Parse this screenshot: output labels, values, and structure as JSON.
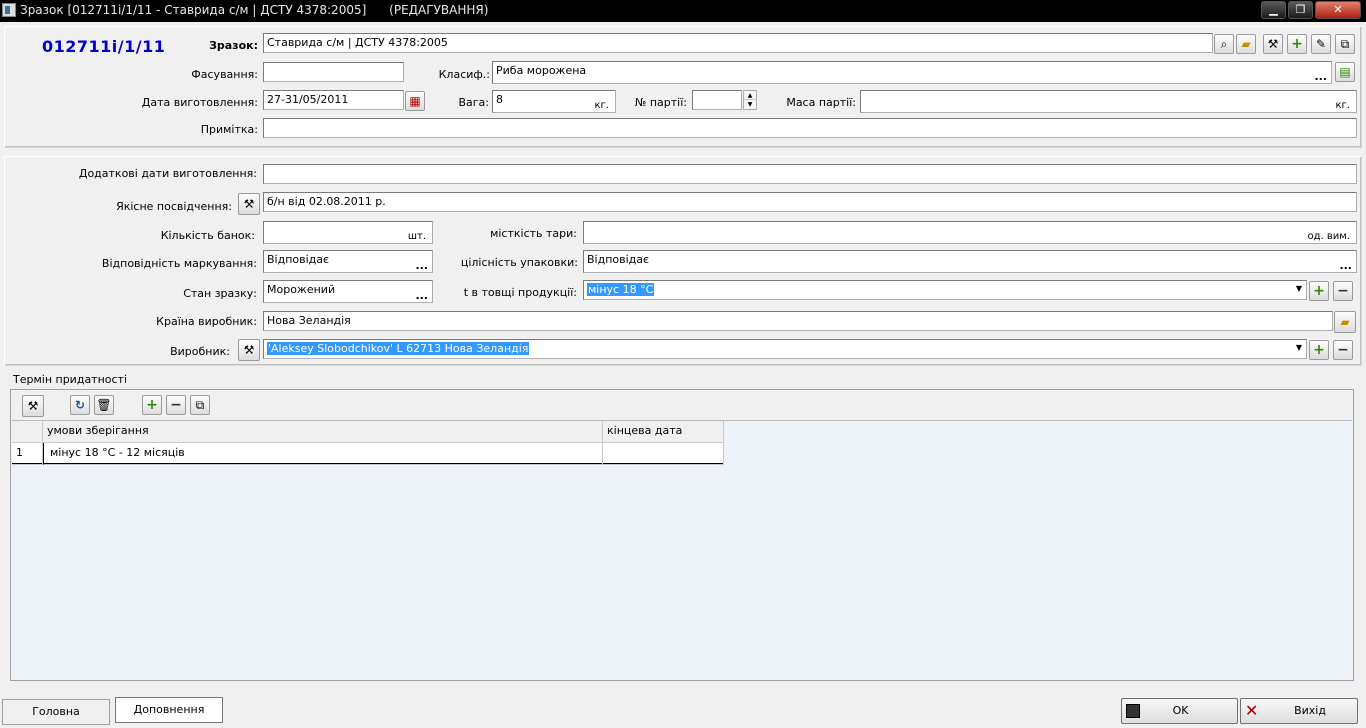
{
  "window": {
    "title": "Зразок [012711i/1/11 - Ставрида с/м | ДСТУ 4378:2005]      (РЕДАГУВАННЯ)"
  },
  "header": {
    "code": "012711i/1/11",
    "sample_label": "Зразок:",
    "sample_value": "Ставрида с/м | ДСТУ 4378:2005",
    "packing_label": "Фасування:",
    "packing_value": "",
    "class_label": "Класиф.:",
    "class_value": "Риба морожена",
    "mfg_date_label": "Дата виготовлення:",
    "mfg_date_value": "27-31/05/2011",
    "weight_label": "Вага:",
    "weight_value": "8",
    "weight_unit": "кг.",
    "batch_label": "№ партії:",
    "batch_value": "",
    "batch_mass_label": "Маса партії:",
    "batch_mass_value": "",
    "batch_mass_unit": "кг.",
    "note_label": "Примітка:",
    "note_value": ""
  },
  "details": {
    "extra_dates_label": "Додаткові дати виготовлення:",
    "extra_dates_value": "",
    "quality_cert_label": "Якісне посвідчення:",
    "quality_cert_value": "б/н від 02.08.2011 р.",
    "cans_label": "Кількість банок:",
    "cans_value": "",
    "cans_unit": "шт.",
    "capacity_label": "місткість тари:",
    "capacity_value": "",
    "capacity_unit": "од. вим.",
    "marking_label": "Відповідність маркування:",
    "marking_value": "Відповідає",
    "integrity_label": "цілісність упаковки:",
    "integrity_value": "Відповідає",
    "state_label": "Стан зразку:",
    "state_value": "Морожений",
    "temp_label": "t в товщі продукції:",
    "temp_value": "мінус 18 °С",
    "country_label": "Країна виробник:",
    "country_value": "Нова Зеландія",
    "producer_label": "Виробник:",
    "producer_value": "'Aleksey Slobodchikov' L 62713 Нова Зеландія"
  },
  "shelf_life": {
    "group_title": "Термін придатності",
    "columns": [
      "умови зберігання",
      "кінцева дата"
    ],
    "rows": [
      {
        "num": "1",
        "conditions": "мінус 18 °С - 12 місяців",
        "end_date": ""
      }
    ]
  },
  "footer": {
    "tab_main": "Головна",
    "tab_extra": "Доповнення",
    "ok_label": "OK",
    "exit_label": "Вихід"
  },
  "icons": {
    "search": "binoculars-icon",
    "open": "folder-icon",
    "tools": "tools-icon",
    "add": "plus-icon",
    "edit": "pencil-icon",
    "copy": "copy-icon",
    "calendar": "calendar-icon",
    "refresh": "refresh-icon",
    "delete": "trash-icon",
    "remove": "minus-icon",
    "save": "disk-icon",
    "close": "x-icon"
  },
  "colors": {
    "code_blue": "#0000cc",
    "selection": "#3399ff",
    "titlebar": "#000000"
  }
}
